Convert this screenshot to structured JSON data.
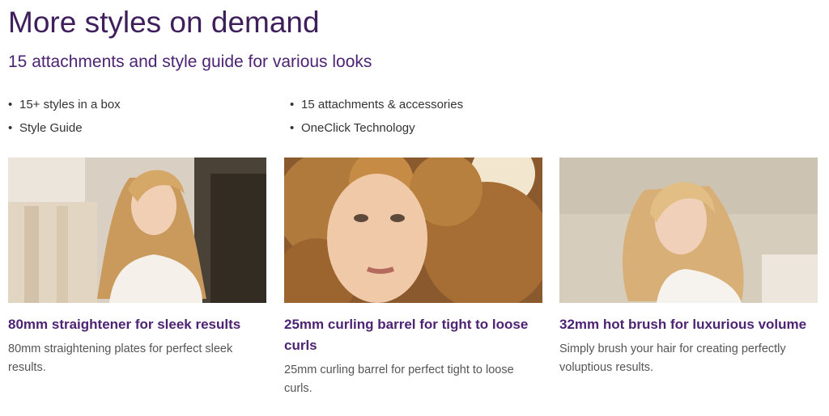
{
  "header": {
    "title": "More styles on demand",
    "subtitle": "15 attachments and style guide for various looks"
  },
  "features": {
    "left": [
      "15+ styles in a box",
      "Style Guide"
    ],
    "right": [
      "15 attachments & accessories",
      "OneClick Technology"
    ]
  },
  "cards": [
    {
      "title": "80mm straightener for sleek results",
      "text": "80mm straightening plates for perfect sleek results."
    },
    {
      "title": "25mm curling barrel for tight to loose curls",
      "text": "25mm curling barrel for perfect tight to loose curls."
    },
    {
      "title": "32mm hot brush for luxurious volume",
      "text": "Simply brush your hair for creating perfectly voluptious results."
    }
  ],
  "colors": {
    "heading": "#3f1e5c",
    "accent": "#4d2373",
    "body_text": "#555555"
  }
}
